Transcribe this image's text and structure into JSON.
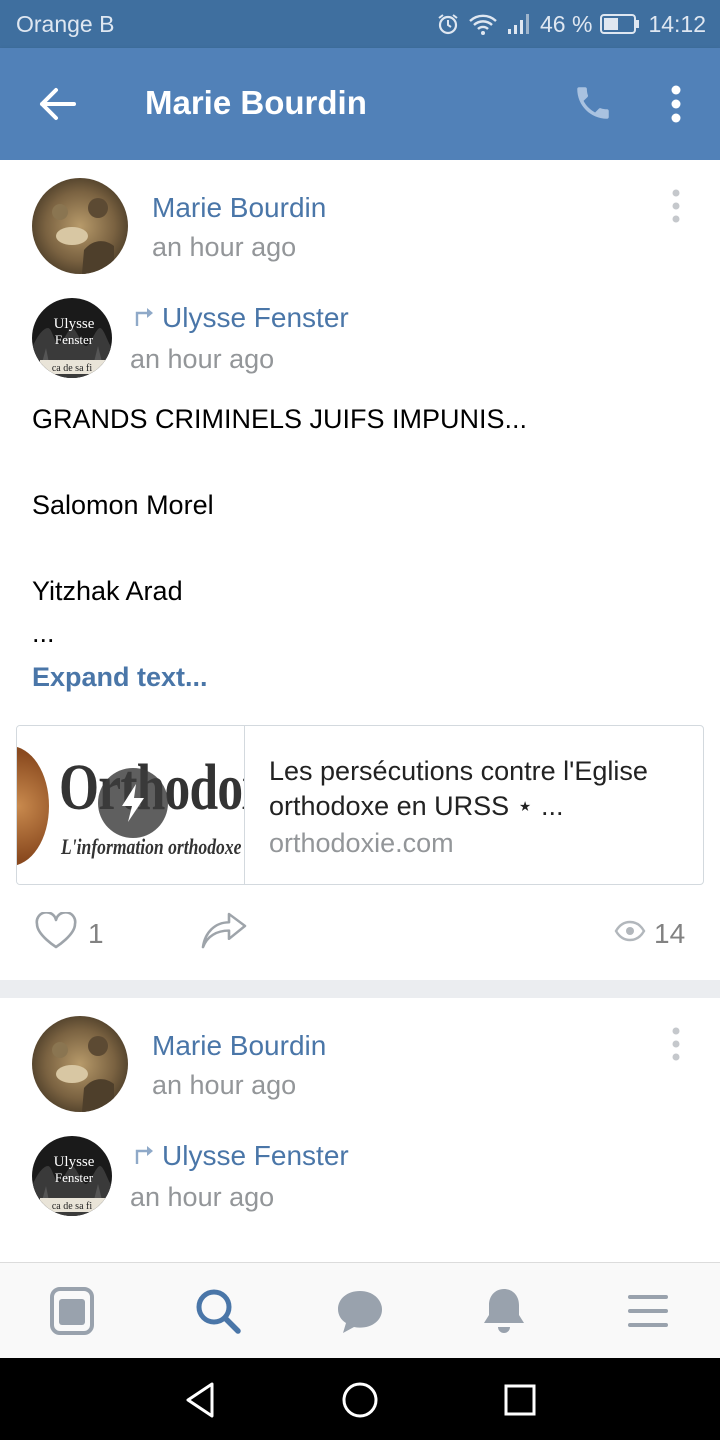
{
  "status_bar": {
    "carrier": "Orange B",
    "battery": "46 %",
    "time": "14:12"
  },
  "header": {
    "title": "Marie Bourdin"
  },
  "posts": [
    {
      "author": "Marie Bourdin",
      "time": "an hour ago",
      "repost": {
        "author": "Ulysse Fenster",
        "time": "an hour ago"
      },
      "text_lines": [
        "GRANDS CRIMINELS JUIFS IMPUNIS...",
        "Salomon Morel",
        "Yitzhak Arad",
        "..."
      ],
      "expand_label": "Expand text...",
      "link": {
        "title": "Les persécutions contre l'Eglise orthodoxe en URSS ⋆ ...",
        "domain": "orthodoxie.com",
        "thumb_logo": "Orthodoxie",
        "thumb_tagline": "L'information orthodoxe"
      },
      "likes": "1",
      "views": "14"
    },
    {
      "author": "Marie Bourdin",
      "time": "an hour ago",
      "repost": {
        "author": "Ulysse Fenster",
        "time": "an hour ago"
      }
    }
  ],
  "repost_avatar_text": {
    "line1": "Ulysse",
    "line2": "Fenster",
    "line3": "ca de sa fi"
  },
  "icons": {
    "back": "arrow-left-icon",
    "call": "phone-icon",
    "more": "more-vertical-icon",
    "repost": "repost-arrow-icon",
    "like": "heart-icon",
    "share": "share-icon",
    "views": "eye-icon",
    "nav": [
      "news-icon",
      "search-icon",
      "messages-icon",
      "notifications-icon",
      "menu-icon"
    ],
    "system": [
      "back-triangle-icon",
      "home-circle-icon",
      "recents-square-icon"
    ]
  },
  "colors": {
    "status_bar": "#3f6f9f",
    "app_bar": "#5181b8",
    "link": "#4a76a8",
    "active_nav": "#4a76a8",
    "muted": "#939699"
  }
}
